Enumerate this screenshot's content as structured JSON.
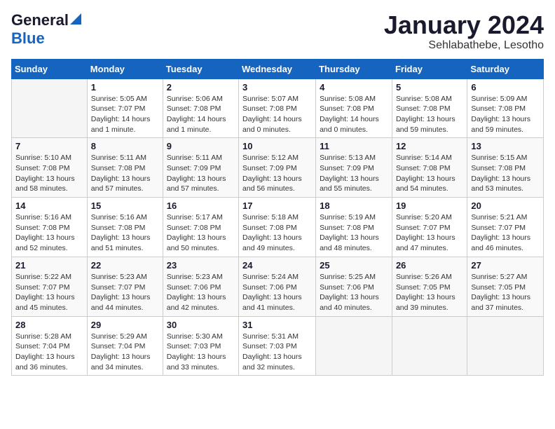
{
  "header": {
    "logo_general": "General",
    "logo_blue": "Blue",
    "month_title": "January 2024",
    "location": "Sehlabathebe, Lesotho"
  },
  "days_of_week": [
    "Sunday",
    "Monday",
    "Tuesday",
    "Wednesday",
    "Thursday",
    "Friday",
    "Saturday"
  ],
  "weeks": [
    [
      {
        "day": "",
        "sunrise": "",
        "sunset": "",
        "daylight": ""
      },
      {
        "day": "1",
        "sunrise": "Sunrise: 5:05 AM",
        "sunset": "Sunset: 7:07 PM",
        "daylight": "Daylight: 14 hours and 1 minute."
      },
      {
        "day": "2",
        "sunrise": "Sunrise: 5:06 AM",
        "sunset": "Sunset: 7:08 PM",
        "daylight": "Daylight: 14 hours and 1 minute."
      },
      {
        "day": "3",
        "sunrise": "Sunrise: 5:07 AM",
        "sunset": "Sunset: 7:08 PM",
        "daylight": "Daylight: 14 hours and 0 minutes."
      },
      {
        "day": "4",
        "sunrise": "Sunrise: 5:08 AM",
        "sunset": "Sunset: 7:08 PM",
        "daylight": "Daylight: 14 hours and 0 minutes."
      },
      {
        "day": "5",
        "sunrise": "Sunrise: 5:08 AM",
        "sunset": "Sunset: 7:08 PM",
        "daylight": "Daylight: 13 hours and 59 minutes."
      },
      {
        "day": "6",
        "sunrise": "Sunrise: 5:09 AM",
        "sunset": "Sunset: 7:08 PM",
        "daylight": "Daylight: 13 hours and 59 minutes."
      }
    ],
    [
      {
        "day": "7",
        "sunrise": "Sunrise: 5:10 AM",
        "sunset": "Sunset: 7:08 PM",
        "daylight": "Daylight: 13 hours and 58 minutes."
      },
      {
        "day": "8",
        "sunrise": "Sunrise: 5:11 AM",
        "sunset": "Sunset: 7:08 PM",
        "daylight": "Daylight: 13 hours and 57 minutes."
      },
      {
        "day": "9",
        "sunrise": "Sunrise: 5:11 AM",
        "sunset": "Sunset: 7:09 PM",
        "daylight": "Daylight: 13 hours and 57 minutes."
      },
      {
        "day": "10",
        "sunrise": "Sunrise: 5:12 AM",
        "sunset": "Sunset: 7:09 PM",
        "daylight": "Daylight: 13 hours and 56 minutes."
      },
      {
        "day": "11",
        "sunrise": "Sunrise: 5:13 AM",
        "sunset": "Sunset: 7:09 PM",
        "daylight": "Daylight: 13 hours and 55 minutes."
      },
      {
        "day": "12",
        "sunrise": "Sunrise: 5:14 AM",
        "sunset": "Sunset: 7:08 PM",
        "daylight": "Daylight: 13 hours and 54 minutes."
      },
      {
        "day": "13",
        "sunrise": "Sunrise: 5:15 AM",
        "sunset": "Sunset: 7:08 PM",
        "daylight": "Daylight: 13 hours and 53 minutes."
      }
    ],
    [
      {
        "day": "14",
        "sunrise": "Sunrise: 5:16 AM",
        "sunset": "Sunset: 7:08 PM",
        "daylight": "Daylight: 13 hours and 52 minutes."
      },
      {
        "day": "15",
        "sunrise": "Sunrise: 5:16 AM",
        "sunset": "Sunset: 7:08 PM",
        "daylight": "Daylight: 13 hours and 51 minutes."
      },
      {
        "day": "16",
        "sunrise": "Sunrise: 5:17 AM",
        "sunset": "Sunset: 7:08 PM",
        "daylight": "Daylight: 13 hours and 50 minutes."
      },
      {
        "day": "17",
        "sunrise": "Sunrise: 5:18 AM",
        "sunset": "Sunset: 7:08 PM",
        "daylight": "Daylight: 13 hours and 49 minutes."
      },
      {
        "day": "18",
        "sunrise": "Sunrise: 5:19 AM",
        "sunset": "Sunset: 7:08 PM",
        "daylight": "Daylight: 13 hours and 48 minutes."
      },
      {
        "day": "19",
        "sunrise": "Sunrise: 5:20 AM",
        "sunset": "Sunset: 7:07 PM",
        "daylight": "Daylight: 13 hours and 47 minutes."
      },
      {
        "day": "20",
        "sunrise": "Sunrise: 5:21 AM",
        "sunset": "Sunset: 7:07 PM",
        "daylight": "Daylight: 13 hours and 46 minutes."
      }
    ],
    [
      {
        "day": "21",
        "sunrise": "Sunrise: 5:22 AM",
        "sunset": "Sunset: 7:07 PM",
        "daylight": "Daylight: 13 hours and 45 minutes."
      },
      {
        "day": "22",
        "sunrise": "Sunrise: 5:23 AM",
        "sunset": "Sunset: 7:07 PM",
        "daylight": "Daylight: 13 hours and 44 minutes."
      },
      {
        "day": "23",
        "sunrise": "Sunrise: 5:23 AM",
        "sunset": "Sunset: 7:06 PM",
        "daylight": "Daylight: 13 hours and 42 minutes."
      },
      {
        "day": "24",
        "sunrise": "Sunrise: 5:24 AM",
        "sunset": "Sunset: 7:06 PM",
        "daylight": "Daylight: 13 hours and 41 minutes."
      },
      {
        "day": "25",
        "sunrise": "Sunrise: 5:25 AM",
        "sunset": "Sunset: 7:06 PM",
        "daylight": "Daylight: 13 hours and 40 minutes."
      },
      {
        "day": "26",
        "sunrise": "Sunrise: 5:26 AM",
        "sunset": "Sunset: 7:05 PM",
        "daylight": "Daylight: 13 hours and 39 minutes."
      },
      {
        "day": "27",
        "sunrise": "Sunrise: 5:27 AM",
        "sunset": "Sunset: 7:05 PM",
        "daylight": "Daylight: 13 hours and 37 minutes."
      }
    ],
    [
      {
        "day": "28",
        "sunrise": "Sunrise: 5:28 AM",
        "sunset": "Sunset: 7:04 PM",
        "daylight": "Daylight: 13 hours and 36 minutes."
      },
      {
        "day": "29",
        "sunrise": "Sunrise: 5:29 AM",
        "sunset": "Sunset: 7:04 PM",
        "daylight": "Daylight: 13 hours and 34 minutes."
      },
      {
        "day": "30",
        "sunrise": "Sunrise: 5:30 AM",
        "sunset": "Sunset: 7:03 PM",
        "daylight": "Daylight: 13 hours and 33 minutes."
      },
      {
        "day": "31",
        "sunrise": "Sunrise: 5:31 AM",
        "sunset": "Sunset: 7:03 PM",
        "daylight": "Daylight: 13 hours and 32 minutes."
      },
      {
        "day": "",
        "sunrise": "",
        "sunset": "",
        "daylight": ""
      },
      {
        "day": "",
        "sunrise": "",
        "sunset": "",
        "daylight": ""
      },
      {
        "day": "",
        "sunrise": "",
        "sunset": "",
        "daylight": ""
      }
    ]
  ]
}
